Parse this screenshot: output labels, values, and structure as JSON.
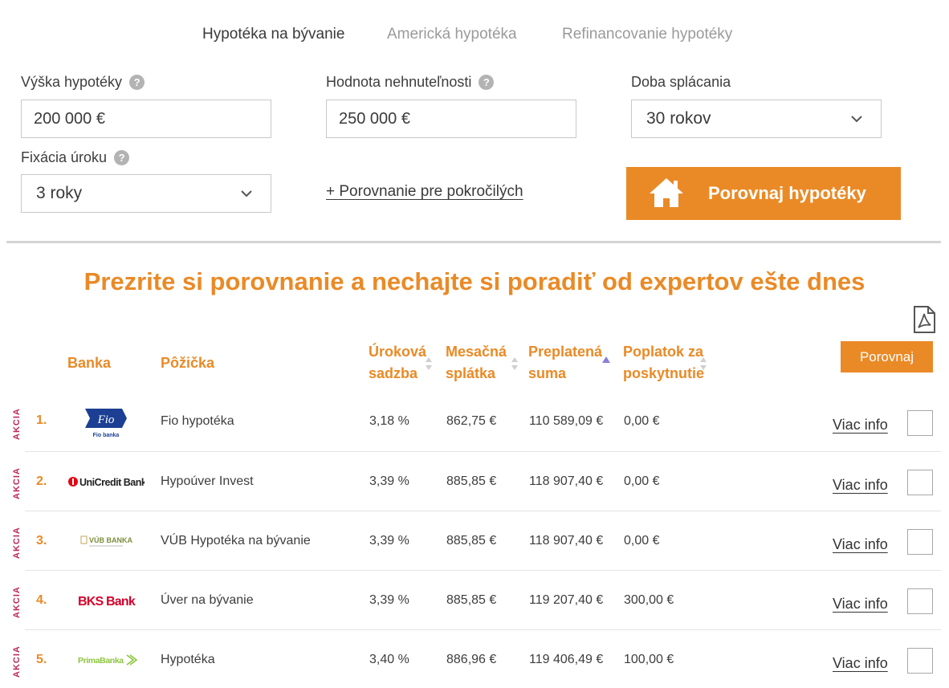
{
  "tabs": [
    {
      "label": "Hypotéka na bývanie",
      "active": true
    },
    {
      "label": "Americká hypotéka",
      "active": false
    },
    {
      "label": "Refinancovanie hypotéky",
      "active": false
    }
  ],
  "form": {
    "loan_amount": {
      "label": "Výška hypotéky",
      "value": "200 000 €"
    },
    "property_value": {
      "label": "Hodnota nehnuteľnosti",
      "value": "250 000 €"
    },
    "term": {
      "label": "Doba splácania",
      "value": "30 rokov"
    },
    "fixation": {
      "label": "Fixácia úroku",
      "value": "3 roky"
    },
    "advanced_link": "+ Porovnanie pre pokročilých",
    "compare_button": "Porovnaj hypotéky",
    "help_glyph": "?"
  },
  "headline": "Prezrite si porovnanie a nechajte si poradiť od expertov ešte dnes",
  "table": {
    "headers": {
      "bank": "Banka",
      "loan": "Pôžička",
      "rate_1": "Úroková",
      "rate_2": "sadzba",
      "monthly_1": "Mesačná",
      "monthly_2": "splátka",
      "overpaid_1": "Preplatená",
      "overpaid_2": "suma",
      "fee_1": "Poplatok za",
      "fee_2": "poskytnutie"
    },
    "compare_button": "Porovnaj",
    "promo_label": "AKCIA",
    "more_info_label": "Viac info",
    "rows": [
      {
        "rank": "1.",
        "bank_logo": "Fio banka",
        "loan": "Fio hypotéka",
        "rate": "3,18 %",
        "monthly": "862,75 €",
        "overpaid": "110 589,09 €",
        "fee": "0,00 €"
      },
      {
        "rank": "2.",
        "bank_logo": "UniCredit Bank",
        "loan": "Hypoúver Invest",
        "rate": "3,39 %",
        "monthly": "885,85 €",
        "overpaid": "118 907,40 €",
        "fee": "0,00 €"
      },
      {
        "rank": "3.",
        "bank_logo": "VÚB BANKA",
        "loan": "VÚB Hypotéka na bývanie",
        "rate": "3,39 %",
        "monthly": "885,85 €",
        "overpaid": "118 907,40 €",
        "fee": "0,00 €"
      },
      {
        "rank": "4.",
        "bank_logo": "BKS Bank",
        "loan": "Úver na bývanie",
        "rate": "3,39 %",
        "monthly": "885,85 €",
        "overpaid": "119 207,40 €",
        "fee": "300,00 €"
      },
      {
        "rank": "5.",
        "bank_logo": "PrimaBanka",
        "loan": "Hypotéka",
        "rate": "3,40 %",
        "monthly": "886,96 €",
        "overpaid": "119 406,49 €",
        "fee": "100,00 €"
      }
    ]
  },
  "colors": {
    "accent": "#ea8a26",
    "promo": "#c0285c",
    "text": "#333333",
    "muted": "#9a9a9a"
  }
}
